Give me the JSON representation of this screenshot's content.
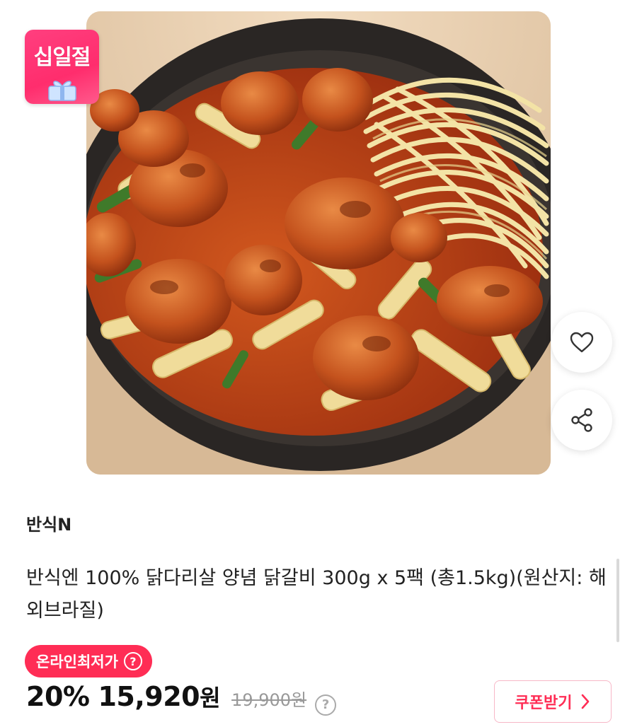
{
  "event_badge": {
    "label": "십일절",
    "icon": "gift-icon",
    "color": "#ff2d6d"
  },
  "product_image": {
    "alt": ""
  },
  "actions": {
    "like_icon": "heart-icon",
    "share_icon": "share-icon"
  },
  "brand": {
    "name": "반식N"
  },
  "product": {
    "title": "반식엔 100% 닭다리살 양념 닭갈비 300g x 5팩 (총1.5kg)(원산지: 해외브라질)"
  },
  "price": {
    "badge_label": "온라인최저가",
    "badge_help": "?",
    "badge_color": "#ff2d55",
    "discount_rate": "20%",
    "sale_price": "15,920",
    "currency": "원",
    "original_price": "19,900원",
    "price_help": "?"
  },
  "coupon": {
    "label": "쿠폰받기",
    "icon": "chevron-right-icon"
  }
}
